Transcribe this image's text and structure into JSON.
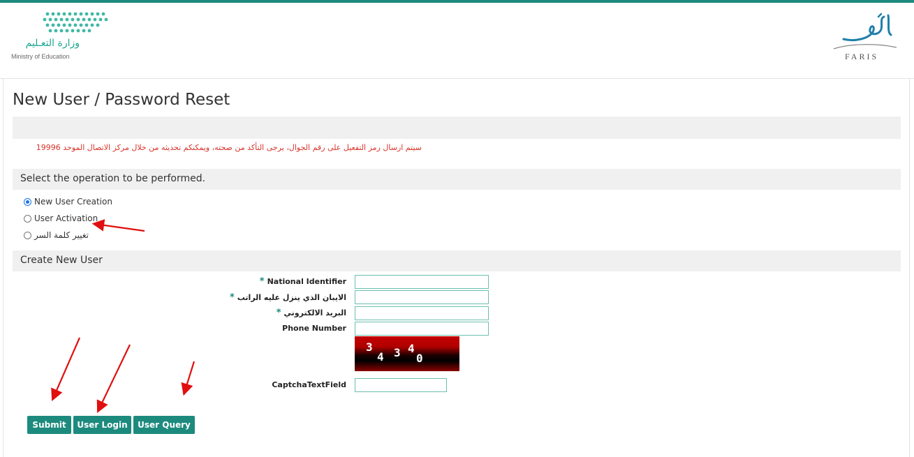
{
  "header": {
    "ministry_name_ar": "وزارة التعـليم",
    "ministry_name_en": "Ministry of Education",
    "faris_brand": "FARIS",
    "brand_color": "#1d8a7e"
  },
  "page": {
    "title": "New User / Password Reset",
    "notice": "سيتم ارسال رمز التفعيل على رقم الجوال، يرجى التأكد من صحته، ويمكنكم تحديثه من خلال مركز الاتصال الموحد 19996",
    "notice_color": "#d9342b"
  },
  "operation": {
    "heading": "Select the operation to be performed.",
    "options": [
      {
        "label": "New User Creation",
        "selected": true
      },
      {
        "label": "User Activation",
        "selected": false
      },
      {
        "label": "تغيير كلمة السر",
        "selected": false
      }
    ]
  },
  "form": {
    "heading": "Create New User",
    "fields": [
      {
        "label": "National Identifier",
        "required": true,
        "value": ""
      },
      {
        "label": "الايبان الذي ينزل عليه الراتب",
        "required": true,
        "value": ""
      },
      {
        "label": "البريد الالكتروني",
        "required": true,
        "value": ""
      },
      {
        "label": "Phone Number",
        "required": false,
        "value": ""
      }
    ],
    "required_mark": "*",
    "captcha_chars": [
      "3",
      "4",
      "3",
      "4",
      "0"
    ],
    "captcha_label": "CaptchaTextField",
    "captcha_value": ""
  },
  "buttons": {
    "submit": "Submit",
    "user_login": "User Login",
    "user_query": "User Query"
  }
}
